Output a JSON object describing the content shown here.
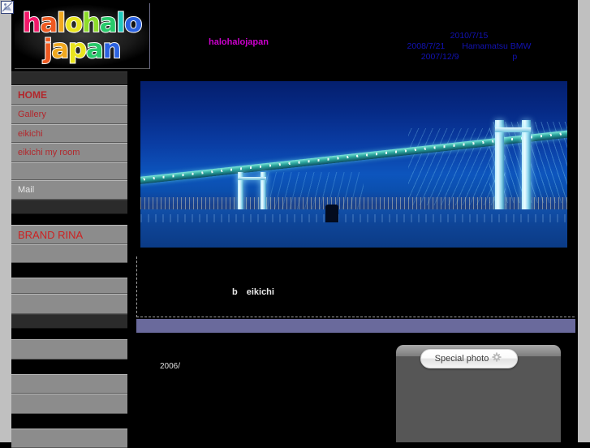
{
  "site": {
    "logo_line1": "halohalo",
    "logo_line2": "japan",
    "title_text": "halohalojapan"
  },
  "header": {
    "news": [
      "2010/7/15",
      "2008/7/21　　Hamamatsu BMW",
      "2007/12/9　　　　　　 p"
    ],
    "news_color": "#1212b4",
    "title_color": "#cc00cc"
  },
  "sidebar": {
    "items": [
      {
        "label": "",
        "style": "dark"
      },
      {
        "label": "HOME",
        "style": "home"
      },
      {
        "label": "Gallery",
        "style": "gray"
      },
      {
        "label": "eikichi",
        "style": "gray"
      },
      {
        "label": "eikichi my room",
        "style": "gray"
      },
      {
        "label": "",
        "style": "gray"
      },
      {
        "label": "Mail",
        "style": "mail"
      },
      {
        "label": "",
        "style": "dark"
      },
      {
        "label": "",
        "style": "black"
      },
      {
        "label": "BRAND RINA",
        "style": "brand"
      },
      {
        "label": "",
        "style": "gray"
      },
      {
        "label": "",
        "style": "black"
      },
      {
        "label": "",
        "style": "gray"
      },
      {
        "label": "",
        "style": "gray"
      },
      {
        "label": "",
        "style": "dark"
      },
      {
        "label": "",
        "style": "black"
      },
      {
        "label": "",
        "style": "gray"
      },
      {
        "label": "",
        "style": "black"
      },
      {
        "label": "",
        "style": "gray"
      },
      {
        "label": "",
        "style": "gray"
      },
      {
        "label": "",
        "style": "black"
      },
      {
        "label": "",
        "style": "gray"
      }
    ]
  },
  "main": {
    "photo_alt": "yokohama-bay-bridge-night",
    "article_text": "b　eikichi",
    "year_label": "2006/",
    "panel": {
      "button_label": "Special photo",
      "button_icon": "sparkle-icon"
    },
    "purple_bar_color": "#6a6a9c"
  }
}
